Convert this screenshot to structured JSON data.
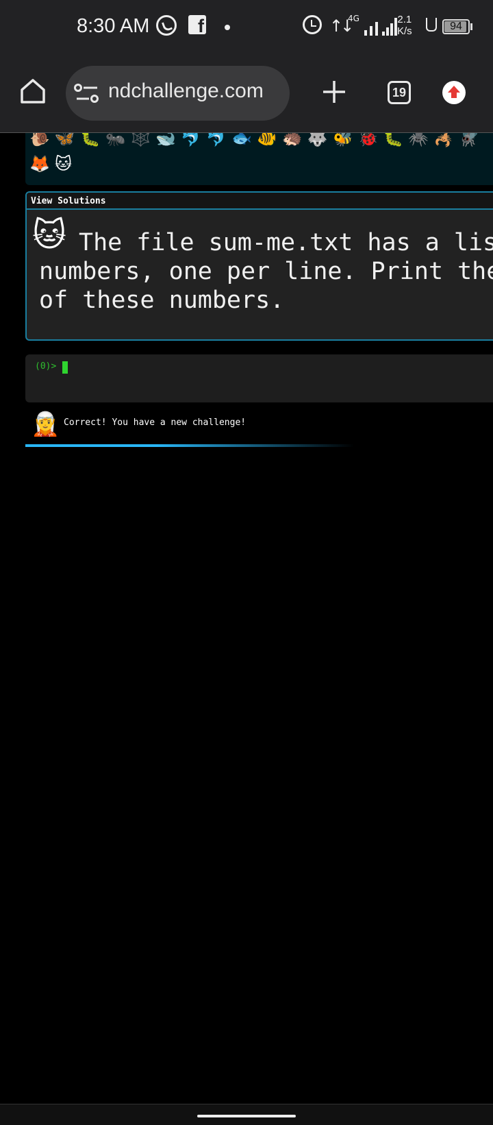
{
  "status_bar": {
    "time": "8:30 AM",
    "network_type": "4G",
    "speed_value": "2.1",
    "speed_unit": "K/s",
    "battery": "94",
    "battery_fraction": 0.94,
    "icons": [
      "whatsapp-icon",
      "facebook-icon",
      "notification-dot-icon",
      "alarm-icon",
      "data-arrows-icon",
      "signal-icon",
      "flask-icon",
      "battery-icon"
    ]
  },
  "browser": {
    "url": "ndchallenge.com",
    "tab_count": "19",
    "icons": [
      "home-icon",
      "site-info-icon",
      "plus-icon",
      "tab-switcher-icon",
      "update-arrow-icon"
    ]
  },
  "emoji_panel": {
    "row1": "🐌🦋🐛🐜🕸️🐋🐬🐬🐟🐠🦔🐺🐝🐞🐛🕷️🦂🪰",
    "row2": "🦊🐱"
  },
  "challenge": {
    "header": "View Solutions",
    "avatar": "🐱",
    "text": "The file sum-me.txt has a list of numbers, one per line. Print the sum of these numbers."
  },
  "terminal": {
    "prompt": "(0)>"
  },
  "message": {
    "icon": "🧝",
    "text": "Correct! You have a new challenge!"
  },
  "progress": {
    "fraction": 0.96,
    "color": "#29b6f6"
  }
}
